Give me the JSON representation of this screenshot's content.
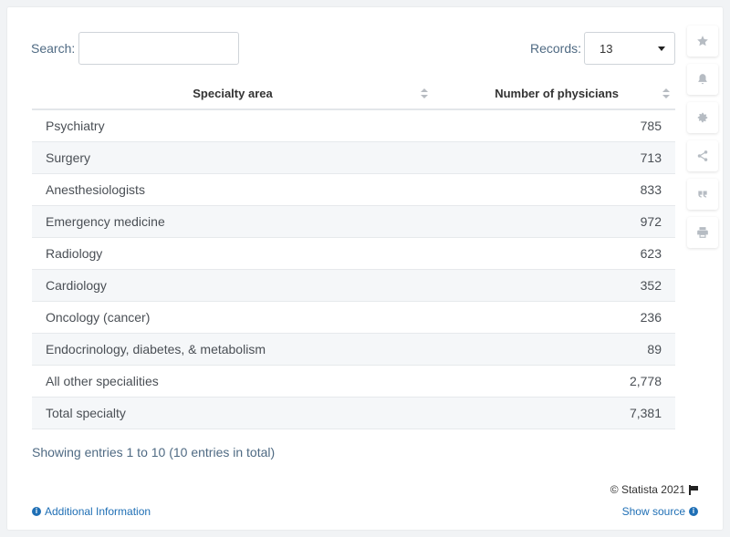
{
  "search": {
    "label": "Search:",
    "value": "",
    "placeholder": ""
  },
  "records": {
    "label": "Records:",
    "selected": "13"
  },
  "table": {
    "headers": [
      "Specialty area",
      "Number of physicians"
    ],
    "rows": [
      {
        "specialty": "Psychiatry",
        "physicians": "785"
      },
      {
        "specialty": "Surgery",
        "physicians": "713"
      },
      {
        "specialty": "Anesthesiologists",
        "physicians": "833"
      },
      {
        "specialty": "Emergency medicine",
        "physicians": "972"
      },
      {
        "specialty": "Radiology",
        "physicians": "623"
      },
      {
        "specialty": "Cardiology",
        "physicians": "352"
      },
      {
        "specialty": "Oncology (cancer)",
        "physicians": "236"
      },
      {
        "specialty": "Endocrinology, diabetes, & metabolism",
        "physicians": "89"
      },
      {
        "specialty": "All other specialities",
        "physicians": "2,778"
      },
      {
        "specialty": "Total specialty",
        "physicians": "7,381"
      }
    ]
  },
  "footer": {
    "showing": "Showing entries 1 to 10 (10 entries in total)",
    "copyright": "© Statista 2021",
    "additional_info": "Additional Information",
    "show_source": "Show source"
  },
  "side_tools": [
    "star-icon",
    "bell-icon",
    "gear-icon",
    "share-icon",
    "quote-icon",
    "print-icon"
  ],
  "colors": {
    "link": "#1f6fb5",
    "label": "#4f6a83",
    "stripe": "#f5f7f9",
    "icon": "#b6bcc3"
  }
}
